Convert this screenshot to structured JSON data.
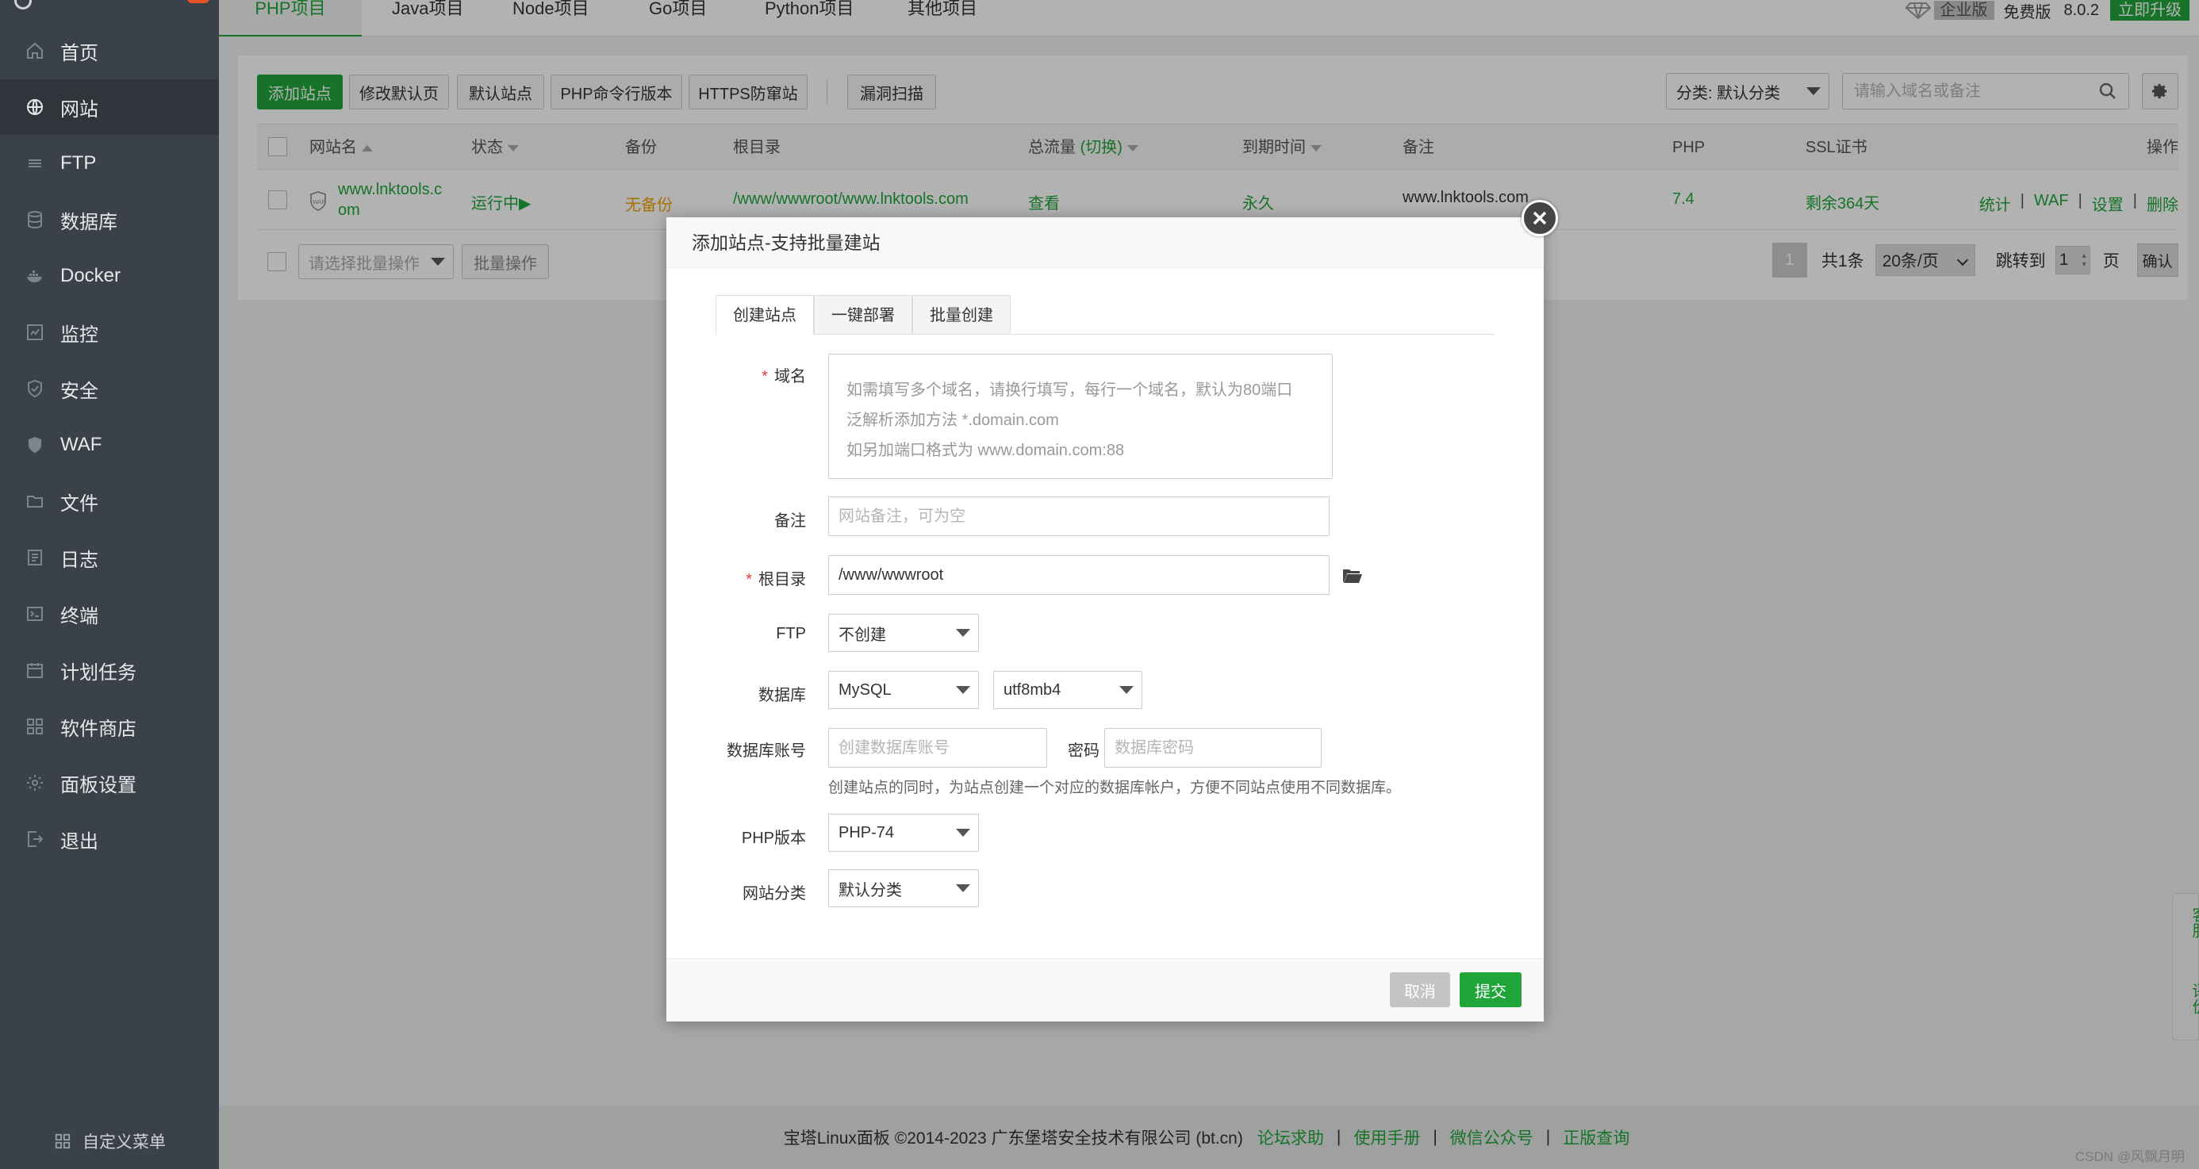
{
  "sidebar": {
    "items": [
      {
        "label": "首页",
        "icon": "home-icon"
      },
      {
        "label": "网站",
        "icon": "globe-icon"
      },
      {
        "label": "FTP",
        "icon": "ftp-icon"
      },
      {
        "label": "数据库",
        "icon": "database-icon"
      },
      {
        "label": "Docker",
        "icon": "docker-icon"
      },
      {
        "label": "监控",
        "icon": "monitor-icon"
      },
      {
        "label": "安全",
        "icon": "shield-icon"
      },
      {
        "label": "WAF",
        "icon": "waf-icon"
      },
      {
        "label": "文件",
        "icon": "folder-icon"
      },
      {
        "label": "日志",
        "icon": "log-icon"
      },
      {
        "label": "终端",
        "icon": "terminal-icon"
      },
      {
        "label": "计划任务",
        "icon": "calendar-icon"
      },
      {
        "label": "软件商店",
        "icon": "apps-icon"
      },
      {
        "label": "面板设置",
        "icon": "gear-icon"
      },
      {
        "label": "退出",
        "icon": "logout-icon"
      }
    ],
    "active_index": 1,
    "custom_menu": "自定义菜单"
  },
  "topbar": {
    "tabs": [
      "PHP项目",
      "Java项目",
      "Node项目",
      "Go项目",
      "Python项目",
      "其他项目"
    ],
    "active_tab": 0,
    "enterprise": "企业版",
    "free": "免费版",
    "version": "8.0.2",
    "upgrade": "立即升级"
  },
  "toolbar": {
    "add_site": "添加站点",
    "modify_default_page": "修改默认页",
    "default_site": "默认站点",
    "php_cli": "PHP命令行版本",
    "https_protect": "HTTPS防窜站",
    "vuln_scan": "漏洞扫描",
    "category_select": "分类: 默认分类",
    "search_placeholder": "请输入域名或备注"
  },
  "table": {
    "headers": {
      "name": "网站名",
      "status": "状态",
      "backup": "备份",
      "root": "根目录",
      "traffic": "总流量",
      "traffic_switch": "(切换)",
      "expire": "到期时间",
      "note": "备注",
      "php": "PHP",
      "ssl": "SSL证书",
      "ops": "操作"
    },
    "rows": [
      {
        "name_line1": "www.lnktools.c",
        "name_line2": "om",
        "status": "运行中▶",
        "backup": "无备份",
        "root": "/www/wwwroot/www.lnktools.com",
        "traffic": "查看",
        "expire": "永久",
        "note": "www.lnktools.com",
        "php": "7.4",
        "ssl": "剩余364天",
        "ops": [
          "统计",
          "WAF",
          "设置",
          "删除"
        ]
      }
    ]
  },
  "batch": {
    "select_placeholder": "请选择批量操作",
    "button": "批量操作"
  },
  "pagination": {
    "current": "1",
    "total": "共1条",
    "per_page": "20条/页",
    "jump_label": "跳转到",
    "jump_value": "1",
    "page_unit": "页",
    "confirm": "确认"
  },
  "dialog": {
    "title": "添加站点-支持批量建站",
    "tabs": [
      "创建站点",
      "一键部署",
      "批量创建"
    ],
    "domain_label": "域名",
    "domain_placeholder": "如需填写多个域名，请换行填写，每行一个域名，默认为80端口\n泛解析添加方法 *.domain.com\n如另加端口格式为 www.domain.com:88",
    "note_label": "备注",
    "note_placeholder": "网站备注，可为空",
    "root_label": "根目录",
    "root_value": "/www/wwwroot",
    "ftp_label": "FTP",
    "ftp_value": "不创建",
    "db_label": "数据库",
    "db_value": "MySQL",
    "db_charset": "utf8mb4",
    "db_account_label": "数据库账号",
    "db_account_placeholder": "创建数据库账号",
    "password_label": "密码",
    "password_placeholder": "数据库密码",
    "db_hint": "创建站点的同时，为站点创建一个对应的数据库帐户，方便不同站点使用不同数据库。",
    "php_label": "PHP版本",
    "php_value": "PHP-74",
    "category_label": "网站分类",
    "category_value": "默认分类",
    "cancel": "取消",
    "submit": "提交"
  },
  "footer": {
    "copyright": "宝塔Linux面板 ©2014-2023 广东堡塔安全技术有限公司 (bt.cn)",
    "links": [
      "论坛求助",
      "使用手册",
      "微信公众号",
      "正版查询"
    ],
    "watermark": "CSDN @风飘月明"
  },
  "rightfloat": {
    "service": "客服",
    "review": "评价"
  },
  "colors": {
    "accent": "#20a53a",
    "sidebar": "#3b4149",
    "warning": "#f0a30a",
    "required": "#e53935"
  }
}
